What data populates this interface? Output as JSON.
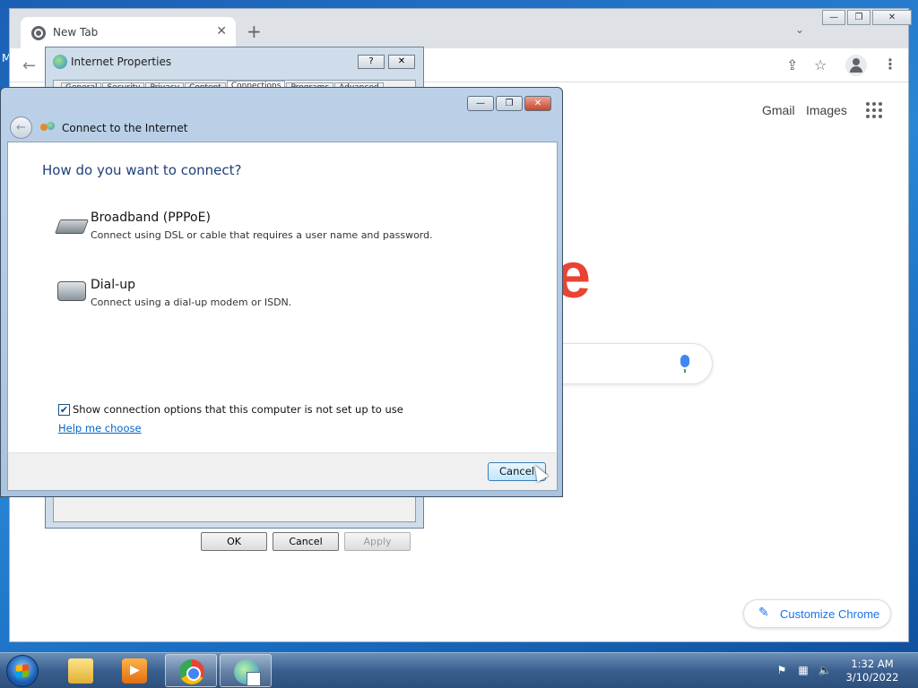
{
  "desktop": {
    "edge_letter": "M"
  },
  "chrome": {
    "tab_title": "New Tab",
    "tab_close": "✕",
    "new_tab": "+",
    "window_controls": {
      "minimize": "—",
      "restore": "❐",
      "close": "✕"
    },
    "header_links": {
      "gmail": "Gmail",
      "images": "Images"
    },
    "logo_fragment": "e",
    "customize_label": "Customize Chrome"
  },
  "internet_properties": {
    "title": "Internet Properties",
    "help_btn": "?",
    "close_btn": "✕",
    "tabs": [
      "General",
      "Security",
      "Privacy",
      "Content",
      "Connections",
      "Programs",
      "Advanced"
    ],
    "active_tab": "Connections",
    "buttons": {
      "ok": "OK",
      "cancel": "Cancel",
      "apply": "Apply"
    }
  },
  "wizard": {
    "nav_title": "Connect to the Internet",
    "heading": "How do you want to connect?",
    "options": [
      {
        "label": "Broadband (PPPoE)",
        "description": "Connect using DSL or cable that requires a user name and password."
      },
      {
        "label": "Dial-up",
        "description": "Connect using a dial-up modem or ISDN."
      }
    ],
    "show_options_checked": true,
    "show_options_label": "Show connection options that this computer is not set up to use",
    "help_link": "Help me choose",
    "cancel_label": "Cancel",
    "window_controls": {
      "minimize": "—",
      "restore": "❐",
      "close": "✕"
    }
  },
  "taskbar": {
    "time": "1:32 AM",
    "date": "3/10/2022",
    "apps": [
      "file-explorer",
      "media-player",
      "chrome",
      "internet-properties"
    ]
  }
}
